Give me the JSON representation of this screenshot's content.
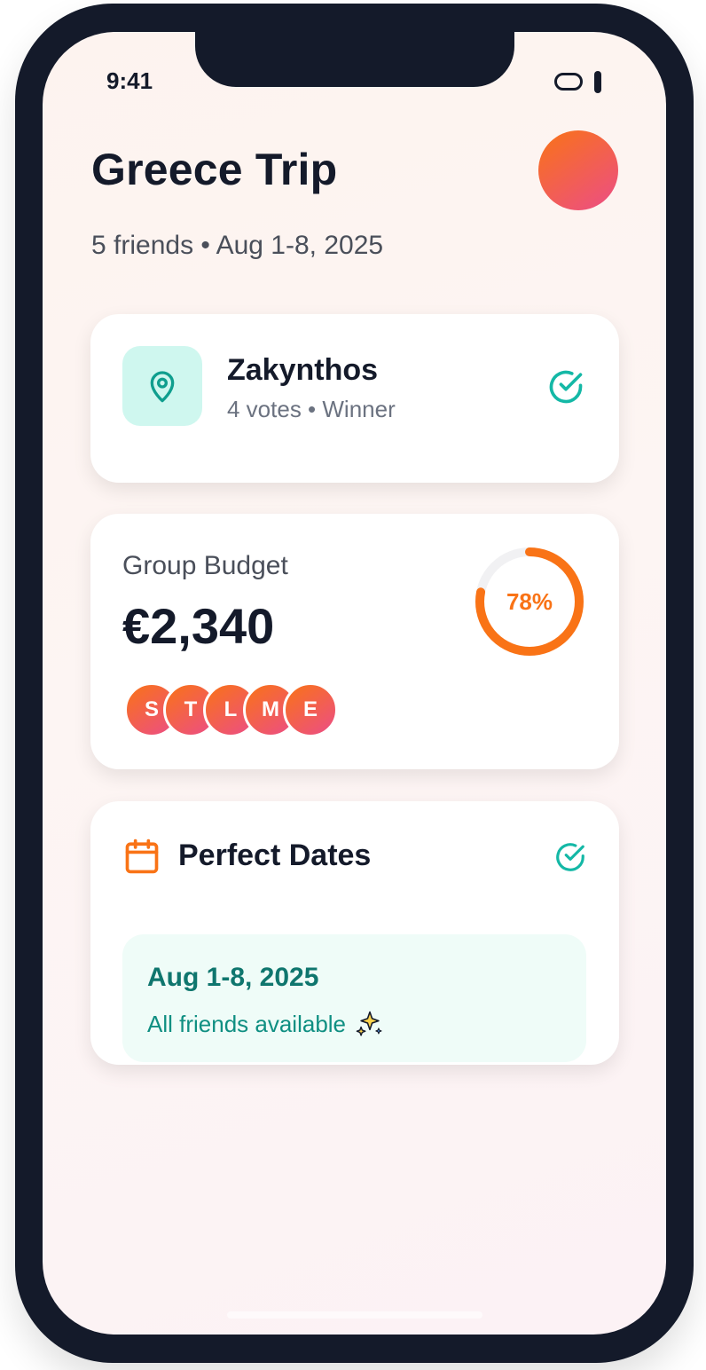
{
  "status_bar": {
    "time": "9:41"
  },
  "header": {
    "title": "Greece Trip",
    "subtitle": "5 friends • Aug 1-8, 2025"
  },
  "destination": {
    "name": "Zakynthos",
    "meta": "4 votes • Winner",
    "icon": "map-pin-icon"
  },
  "budget": {
    "label": "Group Budget",
    "amount": "€2,340",
    "progress_text": "78%",
    "progress_value": 0.78,
    "members": [
      "S",
      "T",
      "L",
      "M",
      "E"
    ]
  },
  "dates": {
    "title": "Perfect Dates",
    "range": "Aug 1-8, 2025",
    "note": "All friends available",
    "note_emoji": "sparkles-icon"
  },
  "colors": {
    "accent_orange": "#f97316",
    "accent_pink": "#ec4d87",
    "teal": "#14b8a6",
    "dark": "#141a2a"
  }
}
